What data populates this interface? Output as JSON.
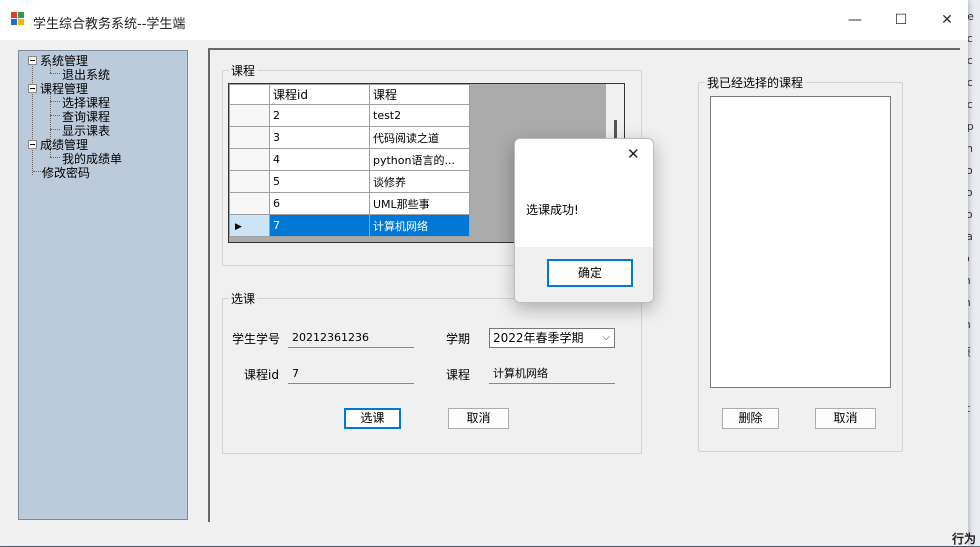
{
  "window": {
    "title": "学生综合教务系统--学生端",
    "controls": {
      "minimize": "—",
      "maximize": "☐",
      "close": "✕"
    }
  },
  "tree": {
    "nodes": [
      {
        "label": "系统管理",
        "level": 0,
        "expanded": true
      },
      {
        "label": "退出系统",
        "level": 1
      },
      {
        "label": "课程管理",
        "level": 0,
        "expanded": true
      },
      {
        "label": "选择课程",
        "level": 1
      },
      {
        "label": "查询课程",
        "level": 1
      },
      {
        "label": "显示课表",
        "level": 1
      },
      {
        "label": "成绩管理",
        "level": 0,
        "expanded": true
      },
      {
        "label": "我的成绩单",
        "level": 1
      },
      {
        "label": "修改密码",
        "level": 0
      }
    ]
  },
  "courses_group": {
    "legend": "课程",
    "columns": [
      "课程id",
      "课程"
    ],
    "rows": [
      {
        "id": "2",
        "name": "test2"
      },
      {
        "id": "3",
        "name": "代码阅读之道"
      },
      {
        "id": "4",
        "name": "python语言的..."
      },
      {
        "id": "5",
        "name": "谈修养"
      },
      {
        "id": "6",
        "name": "UML那些事"
      },
      {
        "id": "7",
        "name": "计算机网络",
        "selected": true
      }
    ],
    "selected_marker": "▶"
  },
  "select_group": {
    "legend": "选课",
    "student_no_label": "学生学号",
    "student_no": "20212361236",
    "term_label": "学期",
    "term_value": "2022年春季学期",
    "course_id_label": "课程id",
    "course_id": "7",
    "course_label": "课程",
    "course_value": "计算机网络",
    "select_button": "选课",
    "cancel_button": "取消"
  },
  "chosen_group": {
    "legend": "我已经选择的课程",
    "items": [],
    "delete_button": "删除",
    "cancel_button": "取消"
  },
  "dialog": {
    "message": "选课成功!",
    "ok_button": "确定",
    "close": "✕"
  },
  "background_strip": {
    "letters": [
      "Re",
      "ac",
      "ac",
      "ac",
      "ac",
      "ap",
      "ch",
      "co",
      "Fo",
      "Fo",
      "ka",
      "lo",
      "m",
      "m",
      "m",
      "原",
      "st",
      "e",
      "e",
      "C"
    ],
    "bottom_text": "行为"
  },
  "colors": {
    "selection": "#0078d7",
    "tree_background": "#bccbdc",
    "window_background": "#f0f0f0"
  }
}
